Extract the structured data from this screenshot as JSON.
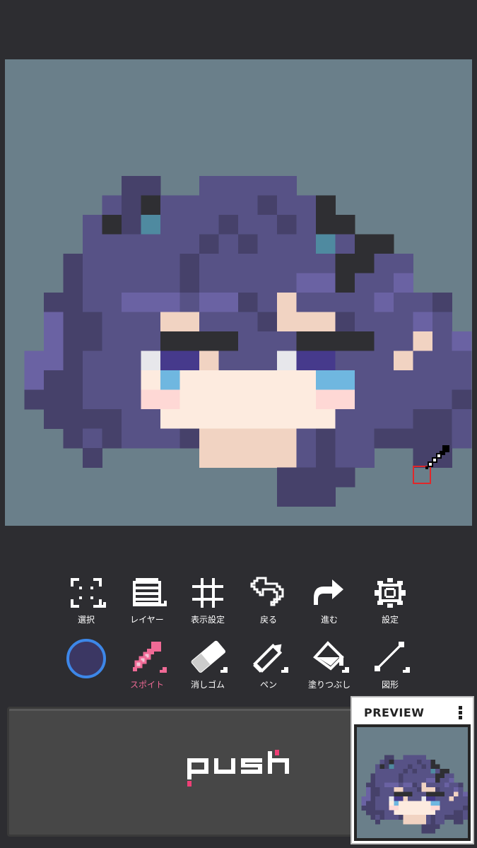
{
  "toolbar_row1": [
    {
      "key": "select",
      "label": "選択",
      "icon": "select-icon"
    },
    {
      "key": "layer",
      "label": "レイヤー",
      "icon": "layers-icon"
    },
    {
      "key": "display",
      "label": "表示設定",
      "icon": "grid-icon"
    },
    {
      "key": "undo",
      "label": "戻る",
      "icon": "undo-arrow-icon"
    },
    {
      "key": "redo",
      "label": "進む",
      "icon": "redo-arrow-icon"
    },
    {
      "key": "settings",
      "label": "設定",
      "icon": "gear-icon"
    }
  ],
  "toolbar_row2": [
    {
      "key": "eyedropper",
      "label": "スポイト",
      "icon": "eyedropper-icon",
      "active": true
    },
    {
      "key": "eraser",
      "label": "消しゴム",
      "icon": "eraser-icon"
    },
    {
      "key": "pen",
      "label": "ペン",
      "icon": "pen-icon"
    },
    {
      "key": "fill",
      "label": "塗りつぶし",
      "icon": "bucket-icon"
    },
    {
      "key": "shape",
      "label": "図形",
      "icon": "line-shape-icon"
    }
  ],
  "current_color": "#3b3763",
  "canvas_background": "#6a7f8a",
  "push_pad": {
    "logo_text": "push",
    "accent": "#ee3f76"
  },
  "preview": {
    "title": "PREVIEW",
    "menu_icon": "more-vertical-icon"
  },
  "colors": {
    "hair_dark": "#46416a",
    "hair_mid": "#575286",
    "hair_light": "#6a62a3",
    "black": "#2f2f33",
    "teal": "#4f8aa0",
    "skin": "#f1d3c2",
    "skin_light": "#fdebdf",
    "blush": "#fed8d5",
    "eye_white": "#e7e7eb",
    "eye_purple": "#463a8c",
    "eye_blue": "#6fb7e0",
    "eye_teal": "#5b9bc0"
  }
}
